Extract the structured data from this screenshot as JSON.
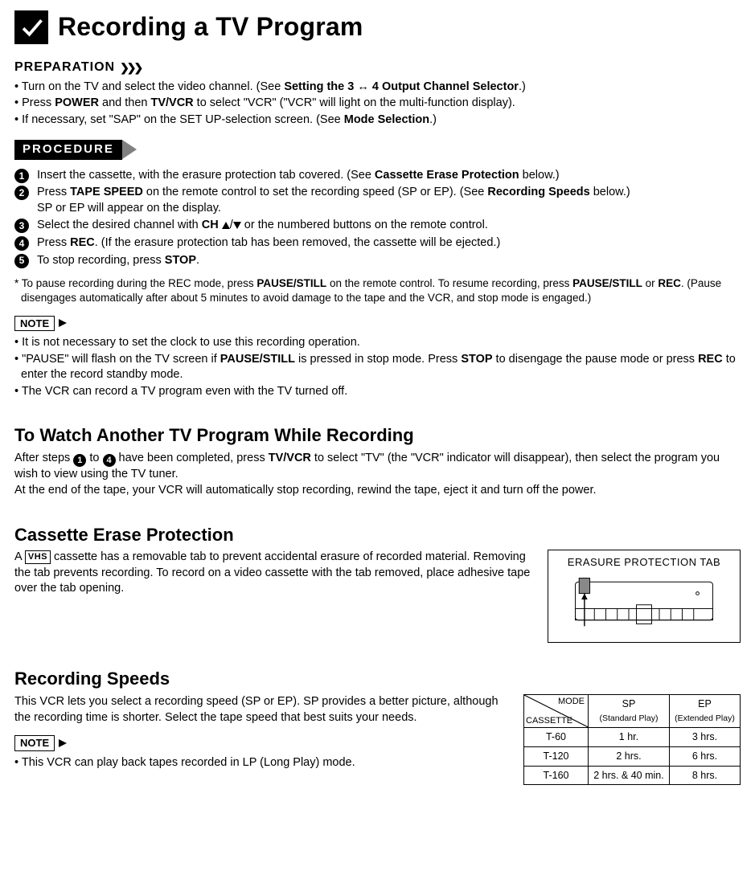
{
  "title": "Recording a TV Program",
  "preparation": {
    "heading": "PREPARATION",
    "items": [
      "• Turn on the TV and select the video channel. (See <b>Setting the 3 ↔ 4 Output Channel Selector</b>.)",
      "• Press <b>POWER</b> and then <b>TV/VCR</b> to select \"VCR\" (\"VCR\" will light on the multi-function display).",
      "• If necessary, set \"SAP\" on the SET UP-selection screen. (See <b>Mode Selection</b>.)"
    ]
  },
  "procedure": {
    "heading": "PROCEDURE",
    "steps": [
      "Insert the cassette, with the erasure protection tab covered. (See <b>Cassette Erase Protection</b> below.)",
      "Press <b>TAPE SPEED</b> on the remote control to set the recording speed (SP or EP). (See <b>Recording Speeds</b> below.)<br>SP or EP will appear on the display.",
      "Select the desired channel with <b>CH</b> ▲/▼ or the numbered buttons on the remote control.",
      "Press <b>REC</b>. (If the erasure protection tab has been removed, the cassette will be ejected.)",
      "To stop recording, press <b>STOP</b>."
    ],
    "footnote": "* To pause recording during the REC mode, press <b>PAUSE/STILL</b> on the remote control. To resume recording, press <b>PAUSE/STILL</b> or <b>REC</b>. (Pause disengages automatically after about 5 minutes to avoid damage to the tape and the VCR, and stop mode is engaged.)"
  },
  "note1": {
    "heading": "NOTE",
    "items": [
      "• It is not necessary to set the clock to use this recording operation.",
      "• \"PAUSE\" will flash on the TV screen if <b>PAUSE/STILL</b> is pressed in stop mode. Press <b>STOP</b> to disengage the pause mode or press <b>REC</b> to enter the record standby mode.",
      "• The VCR can record a TV program even with the TV turned off."
    ]
  },
  "watch_another": {
    "heading": "To Watch Another TV Program While Recording",
    "body_part1": "After steps ",
    "body_mid": " to ",
    "body_part2": " have been completed, press <b>TV/VCR</b> to select \"TV\" (the \"VCR\" indicator will disappear), then select the program you wish to view using the TV tuner.<br>At the end of the tape, your VCR will automatically stop recording, rewind the tape, eject it and turn off the power."
  },
  "erase_protection": {
    "heading": "Cassette Erase Protection",
    "body_prefix": "A ",
    "vhs_label": "VHS",
    "body_rest": " cassette has a removable tab to prevent accidental erasure of recorded material. Removing the tab prevents recording. To record on a video cassette with the tab removed, place adhesive tape over the tab opening.",
    "figure_label": "ERASURE PROTECTION TAB"
  },
  "recording_speeds": {
    "heading": "Recording Speeds",
    "body": "This VCR lets you select a recording speed (SP or EP). SP provides a better picture, although the recording time is shorter. Select the tape speed that best suits your needs.",
    "note_heading": "NOTE",
    "note_body": "• This VCR can play back tapes recorded in LP (Long Play) mode.",
    "table": {
      "diag_mode": "MODE",
      "diag_cassette": "CASSETTE",
      "cols": [
        {
          "label": "SP",
          "sub": "(Standard Play)"
        },
        {
          "label": "EP",
          "sub": "(Extended Play)"
        }
      ],
      "rows": [
        {
          "cassette": "T-60",
          "sp": "1 hr.",
          "ep": "3 hrs."
        },
        {
          "cassette": "T-120",
          "sp": "2 hrs.",
          "ep": "6 hrs."
        },
        {
          "cassette": "T-160",
          "sp": "2 hrs. & 40 min.",
          "ep": "8 hrs."
        }
      ]
    }
  },
  "chart_data": {
    "type": "table",
    "title": "Recording Speeds by Cassette Type",
    "columns": [
      "CASSETTE",
      "SP (Standard Play)",
      "EP (Extended Play)"
    ],
    "rows": [
      [
        "T-60",
        "1 hr.",
        "3 hrs."
      ],
      [
        "T-120",
        "2 hrs.",
        "6 hrs."
      ],
      [
        "T-160",
        "2 hrs. & 40 min.",
        "8 hrs."
      ]
    ]
  }
}
